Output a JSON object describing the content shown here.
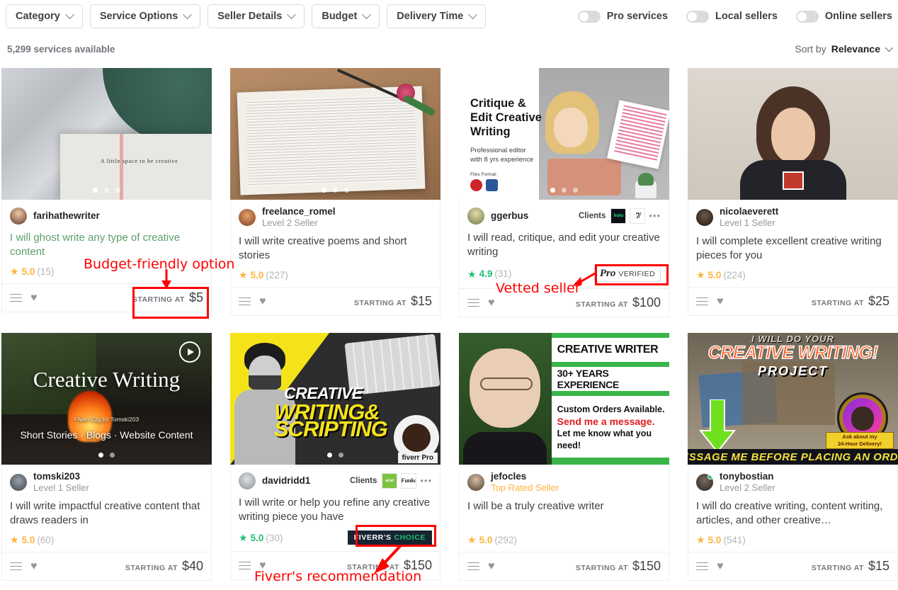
{
  "filters": [
    {
      "label": "Category",
      "icon": "chevron-down-icon"
    },
    {
      "label": "Service Options",
      "icon": "chevron-down-icon"
    },
    {
      "label": "Seller Details",
      "icon": "chevron-down-icon"
    },
    {
      "label": "Budget",
      "icon": "chevron-down-icon"
    },
    {
      "label": "Delivery Time",
      "icon": "chevron-down-icon"
    }
  ],
  "toggles": [
    {
      "label": "Pro services",
      "on": false
    },
    {
      "label": "Local sellers",
      "on": false
    },
    {
      "label": "Online sellers",
      "on": false
    }
  ],
  "results": {
    "count_label": "5,299 services available",
    "sort_prefix": "Sort by",
    "sort_value": "Relevance"
  },
  "labels": {
    "starting_at": "STARTING AT",
    "clients": "Clients",
    "client_more": "•••",
    "pro_word": "Pro",
    "pro_verified": "VERIFIED",
    "choice_first": "FIVERR'S",
    "choice_second": "CHOICE"
  },
  "cards": [
    {
      "seller": "farihathewriter",
      "level": "",
      "title": "I will ghost write any type of creative content",
      "visited": true,
      "rating": "5.0",
      "reviews": "(15)",
      "pro_rating": false,
      "price": "$5",
      "dots": 3,
      "active_dot": 0,
      "online": false,
      "badge": null,
      "clients": null,
      "has_video": false,
      "media": {
        "kind": "photo-book-fabric",
        "overlay_text": "A little space to be creative"
      }
    },
    {
      "seller": "freelance_romel",
      "level": "Level 2 Seller",
      "title": "I will write creative poems and short stories",
      "visited": false,
      "rating": "5.0",
      "reviews": "(227)",
      "pro_rating": false,
      "price": "$15",
      "dots": 3,
      "active_dot": 0,
      "online": false,
      "badge": null,
      "clients": null,
      "has_video": false,
      "media": {
        "kind": "photo-book-rose",
        "overlay_text": ""
      }
    },
    {
      "seller": "ggerbus",
      "level": "",
      "title": "I will read, critique, and edit your creative writing",
      "visited": false,
      "rating": "4.9",
      "reviews": "(31)",
      "pro_rating": true,
      "price": "$100",
      "dots": 3,
      "active_dot": 0,
      "online": false,
      "badge": "pro-verified",
      "clients": [
        "hulu",
        "7d"
      ],
      "has_video": false,
      "media": {
        "kind": "thumb-critique",
        "headline": "Critique &\nEdit Creative\nWriting",
        "sub": "Professional editor\nwith 8 yrs experience",
        "files_label": "Files Format:"
      }
    },
    {
      "seller": "nicolaeverett",
      "level": "Level 1 Seller",
      "title": "I will complete excellent creative writing pieces for you",
      "visited": false,
      "rating": "5.0",
      "reviews": "(224)",
      "pro_rating": false,
      "price": "$25",
      "dots": 3,
      "active_dot": 0,
      "online": false,
      "badge": null,
      "clients": null,
      "has_video": false,
      "media": {
        "kind": "photo-portrait",
        "overlay_text": ""
      }
    },
    {
      "seller": "tomski203",
      "level": "Level 1 Seller",
      "title": "I will write impactful creative content that draws readers in",
      "visited": false,
      "rating": "5.0",
      "reviews": "(60)",
      "pro_rating": false,
      "price": "$40",
      "dots": 2,
      "active_dot": 0,
      "online": false,
      "badge": null,
      "clients": null,
      "has_video": true,
      "media": {
        "kind": "video-campfire",
        "headline": "Creative Writing",
        "byline": "Fiverr Gig by Tomski203",
        "sub": "Short Stories · Blogs · Website Content"
      }
    },
    {
      "seller": "davidridd1",
      "level": "",
      "title": "I will write or help you refine any creative writing piece you have",
      "visited": false,
      "rating": "5.0",
      "reviews": "(30)",
      "pro_rating": true,
      "price": "$150",
      "dots": 2,
      "active_dot": 0,
      "online": false,
      "badge": "fiverrs-choice",
      "clients": [
        "acer",
        "Funko"
      ],
      "has_video": false,
      "media": {
        "kind": "thumb-scripting",
        "line1": "CREATIVE",
        "line2": "WRITING&",
        "line3": "SCRIPTING",
        "corner": "fiverr Pro"
      }
    },
    {
      "seller": "jefocles",
      "level": "Top Rated Seller",
      "title": "I will be a truly creative writer",
      "visited": false,
      "rating": "5.0",
      "reviews": "(292)",
      "pro_rating": false,
      "price": "$150",
      "dots": 0,
      "active_dot": 0,
      "online": false,
      "badge": null,
      "clients": null,
      "has_video": false,
      "media": {
        "kind": "thumb-creative-writer",
        "l1": "CREATIVE WRITER",
        "l2": "30+ YEARS EXPERIENCE",
        "l3": "Custom Orders Available.",
        "l4": "Send me a message.",
        "l5": "Let me know what you need!"
      }
    },
    {
      "seller": "tonybostian",
      "level": "Level 2 Seller",
      "title": "I will do creative writing, content writing, articles, and other creative…",
      "visited": false,
      "rating": "5.0",
      "reviews": "(541)",
      "pro_rating": false,
      "price": "$15",
      "dots": 0,
      "active_dot": 0,
      "online": true,
      "badge": null,
      "clients": null,
      "has_video": false,
      "media": {
        "kind": "thumb-project",
        "top": "I WILL DO YOUR",
        "l1": "CREATIVE WRITING!",
        "l2": "PROJECT",
        "ribbon1": "Ask about my",
        "ribbon2": "24-Hour Delivery!",
        "bottom": "MESSAGE ME BEFORE PLACING AN ORDER"
      }
    }
  ],
  "annotations": [
    {
      "name": "budget-friendly-note",
      "text": "Budget-friendly option"
    },
    {
      "name": "vetted-seller-note",
      "text": "Vetted seller"
    },
    {
      "name": "fiverrs-recommendation-note",
      "text": "Fiverr's recommendation"
    }
  ],
  "colors": {
    "red": "#ff0000",
    "green": "#1dbf73",
    "gold": "#ffb33e",
    "navy": "#172432"
  }
}
